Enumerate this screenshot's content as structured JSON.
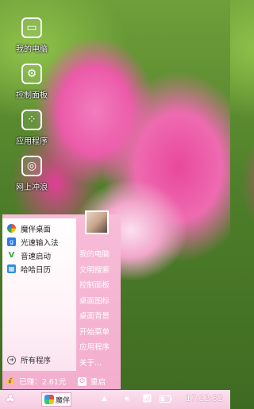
{
  "desktop": {
    "icons": [
      {
        "label": "我的电脑",
        "icon": "monitor-icon",
        "glyph": "▭"
      },
      {
        "label": "控制面板",
        "icon": "gear-icon",
        "glyph": "⚙"
      },
      {
        "label": "应用程序",
        "icon": "apps-grid-icon",
        "glyph": "⁘"
      },
      {
        "label": "网上冲浪",
        "icon": "globe-icon",
        "glyph": "◎"
      }
    ]
  },
  "start_menu": {
    "apps": [
      {
        "label": "魔伴桌面",
        "icon": "pinwheel-icon",
        "color": "#e9552f"
      },
      {
        "label": "光速输入法",
        "icon": "g-keyboard-icon",
        "color": "#2d7be6"
      },
      {
        "label": "音速启动",
        "icon": "v-launcher-icon",
        "color": "#3aa845"
      },
      {
        "label": "哈哈日历",
        "icon": "calendar-icon",
        "color": "#2f8fd8"
      }
    ],
    "all_programs": "所有程序",
    "right_items": [
      "我的电脑",
      "文明搜索",
      "控制面板",
      "桌面图标",
      "桌面背景",
      "开始菜单",
      "应用程序",
      "关于..."
    ],
    "earned": "已赚：2.61元",
    "restart": "重启"
  },
  "taskbar": {
    "task_label": "魔伴",
    "clock": "17:12:32"
  },
  "colors": {
    "menu_pink": "#f3aecd",
    "taskbar_pink": "#f6cbe0"
  }
}
